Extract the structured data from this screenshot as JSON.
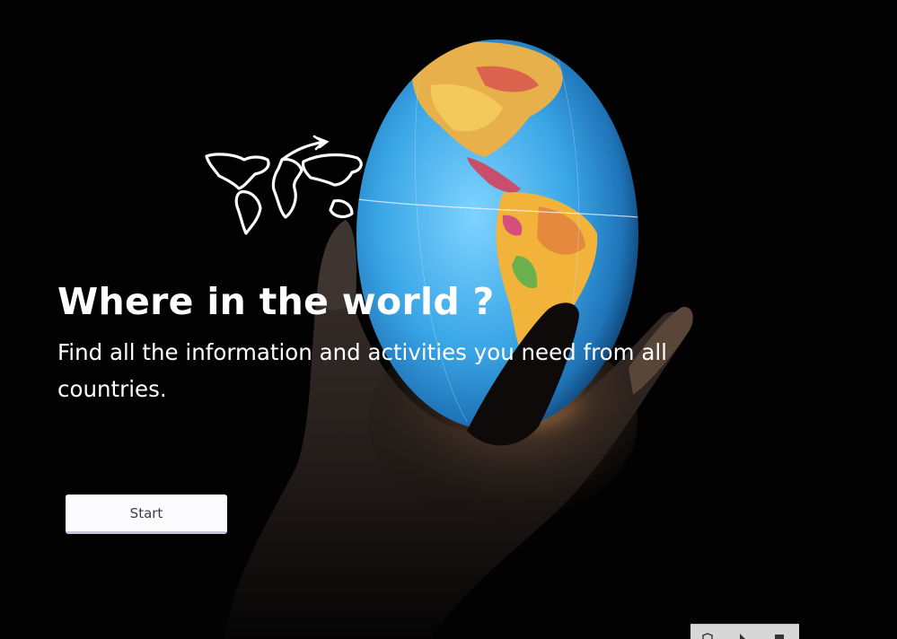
{
  "hero": {
    "title": "Where in the world ?",
    "subtitle": "Find all the information and activities you need from all countries."
  },
  "actions": {
    "start_label": "Start"
  },
  "icons": {
    "logo": "world-map-plane-logo",
    "tray": [
      "shield-icon",
      "play-icon",
      "square-icon"
    ]
  },
  "colors": {
    "background": "#020202",
    "text": "#ffffff",
    "button_bg": "#fbfbfd",
    "button_text": "#3b3b4a",
    "button_border": "#c9c4da",
    "ocean": "#3aa6e6"
  }
}
